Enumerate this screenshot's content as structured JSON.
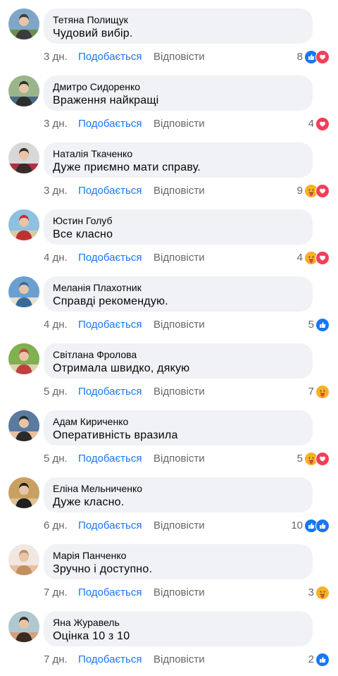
{
  "labels": {
    "like": "Подобається",
    "reply": "Відповісти"
  },
  "colors": {
    "accent": "#1877f2",
    "love": "#f33e58",
    "care": "#f7b125",
    "bubble": "#f0f2f5",
    "muted": "#65676b"
  },
  "comments": [
    {
      "author": "Тетяна Полищук",
      "text": "Чудовий вибір.",
      "time": "3 дн.",
      "count": "8",
      "reactions": [
        "like",
        "love"
      ]
    },
    {
      "author": "Дмитро Сидоренко",
      "text": "Враження найкращі",
      "time": "3 дн.",
      "count": "4",
      "reactions": [
        "love"
      ]
    },
    {
      "author": "Наталія Ткаченко",
      "text": "Дуже приємно мати справу.",
      "time": "3 дн.",
      "count": "9",
      "reactions": [
        "care",
        "love"
      ]
    },
    {
      "author": "Юстин Голуб",
      "text": "Все класно",
      "time": "4 дн.",
      "count": "4",
      "reactions": [
        "care",
        "love"
      ]
    },
    {
      "author": "Меланія Плахотник",
      "text": "Справді рекомендую.",
      "time": "4 дн.",
      "count": "5",
      "reactions": [
        "like"
      ]
    },
    {
      "author": "Світлана Фролова",
      "text": "Отримала швидко, дякую",
      "time": "5 дн.",
      "count": "7",
      "reactions": [
        "care"
      ]
    },
    {
      "author": "Адам Кириченко",
      "text": "Оперативність вразила",
      "time": "5 дн.",
      "count": "5",
      "reactions": [
        "care",
        "love"
      ]
    },
    {
      "author": "Еліна Мельниченко",
      "text": "Дуже класно.",
      "time": "6 дн.",
      "count": "10",
      "reactions": [
        "like",
        "like"
      ]
    },
    {
      "author": "Марія Панченко",
      "text": "Зручно і доступно.",
      "time": "7 дн.",
      "count": "3",
      "reactions": [
        "care"
      ]
    },
    {
      "author": "Яна Журавель",
      "text": "Оцінка 10 з 10",
      "time": "7 дн.",
      "count": "2",
      "reactions": [
        "like"
      ]
    }
  ]
}
